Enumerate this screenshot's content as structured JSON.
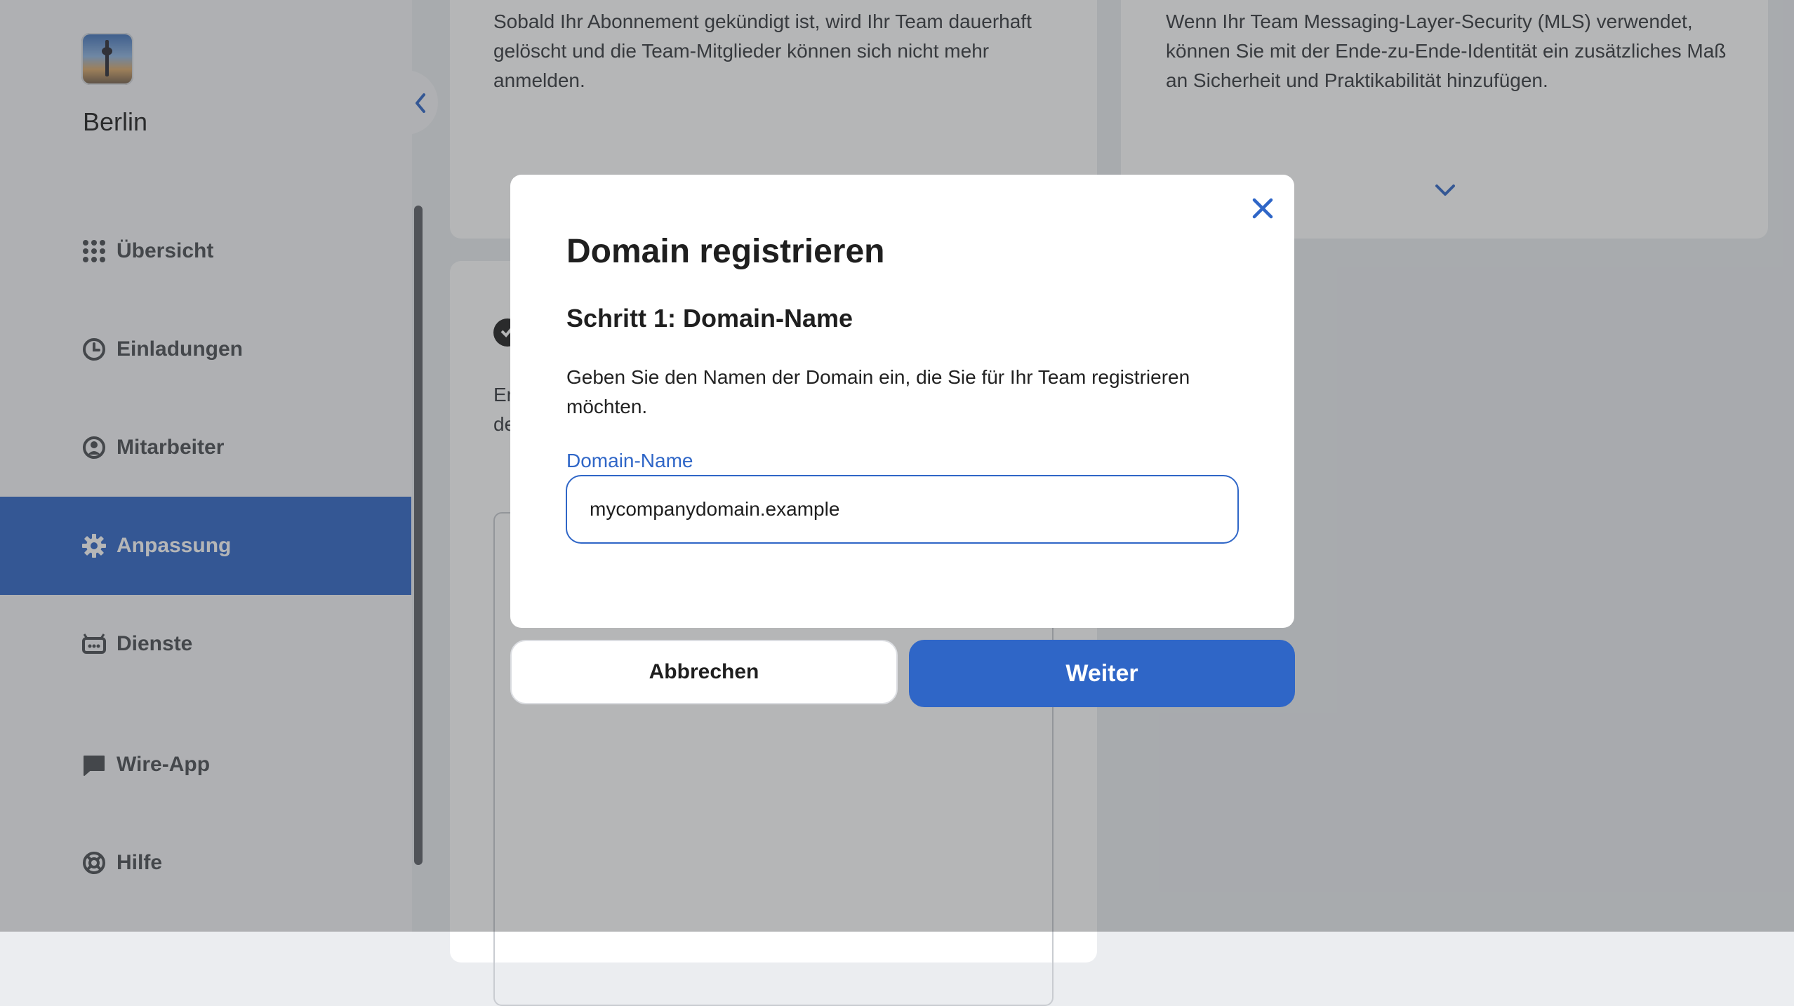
{
  "sidebar": {
    "team_name": "Berlin",
    "items": [
      {
        "label": "Übersicht",
        "icon": "grid-icon"
      },
      {
        "label": "Einladungen",
        "icon": "clock-icon"
      },
      {
        "label": "Mitarbeiter",
        "icon": "user-circle-icon"
      },
      {
        "label": "Anpassung",
        "icon": "gear-icon",
        "active": true
      },
      {
        "label": "Dienste",
        "icon": "robot-icon"
      },
      {
        "label": "Wire-App",
        "icon": "chat-bubble-icon"
      },
      {
        "label": "Hilfe",
        "icon": "lifebuoy-icon"
      }
    ]
  },
  "content": {
    "card_left_text": "Sobald Ihr Abonnement gekündigt ist, wird Ihr Team dauerhaft gelöscht und die Team-Mitglieder können sich nicht mehr anmelden.",
    "card_right_text": "Wenn Ihr Team Messaging-Layer-Security (MLS) verwendet, können Sie mit der Ende-zu-Ende-Identität ein zusätzliches Maß an Sicherheit und Praktikabilität hinzufügen.",
    "card_second_partial": "Er\nde"
  },
  "modal": {
    "title": "Domain registrieren",
    "step": "Schritt 1: Domain-Name",
    "description": "Geben Sie den Namen der Domain ein, die Sie für Ihr Team registrieren möchten.",
    "field_label": "Domain-Name",
    "field_value": "mycompanydomain.example",
    "cancel_label": "Abbrechen",
    "next_label": "Weiter"
  },
  "colors": {
    "accent": "#2f66c7",
    "overlay": "rgba(60,62,66,0.38)"
  }
}
